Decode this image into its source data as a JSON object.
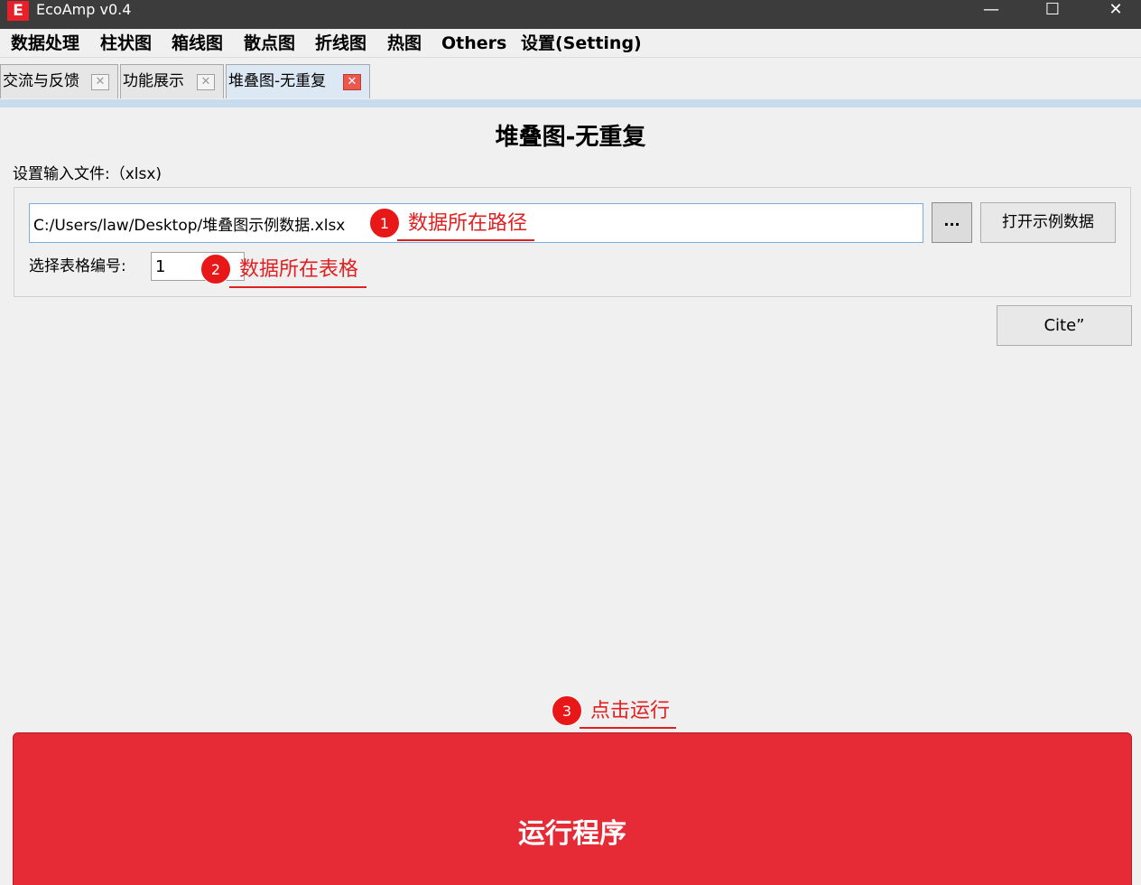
{
  "window": {
    "app_icon_letter": "E",
    "title": "EcoAmp v0.4",
    "minimize_glyph": "—",
    "maximize_glyph": "☐",
    "close_glyph": "✕"
  },
  "menu": [
    {
      "label": "数据处理"
    },
    {
      "label": "柱状图"
    },
    {
      "label": "箱线图"
    },
    {
      "label": "散点图"
    },
    {
      "label": "折线图"
    },
    {
      "label": "热图"
    },
    {
      "label": "Others"
    },
    {
      "label": "设置(Setting)"
    }
  ],
  "tabs": [
    {
      "label": "交流与反馈",
      "active": false
    },
    {
      "label": "功能展示",
      "active": false
    },
    {
      "label": "堆叠图-无重复",
      "active": true
    }
  ],
  "tab_close_glyph": "✕",
  "page": {
    "title": "堆叠图-无重复",
    "input_label": "设置输入文件:（xlsx)",
    "file_path_value": "C:/Users/law/Desktop/堆叠图示例数据.xlsx",
    "browse_label": "...",
    "open_sample_label": "打开示例数据",
    "sheet_label": "选择表格编号:",
    "sheet_value": "1",
    "cite_label": "Cite”",
    "run_label": "运行程序"
  },
  "annotations": [
    {
      "number": "1",
      "text": "数据所在路径",
      "color": "#e02020"
    },
    {
      "number": "2",
      "text": "数据所在表格",
      "color": "#e02020"
    },
    {
      "number": "3",
      "text": "点击运行",
      "color": "#e02020"
    }
  ],
  "colors": {
    "run_button": "#e62a36",
    "annotation_red": "#e81818",
    "titlebar": "#3c3c3c"
  }
}
